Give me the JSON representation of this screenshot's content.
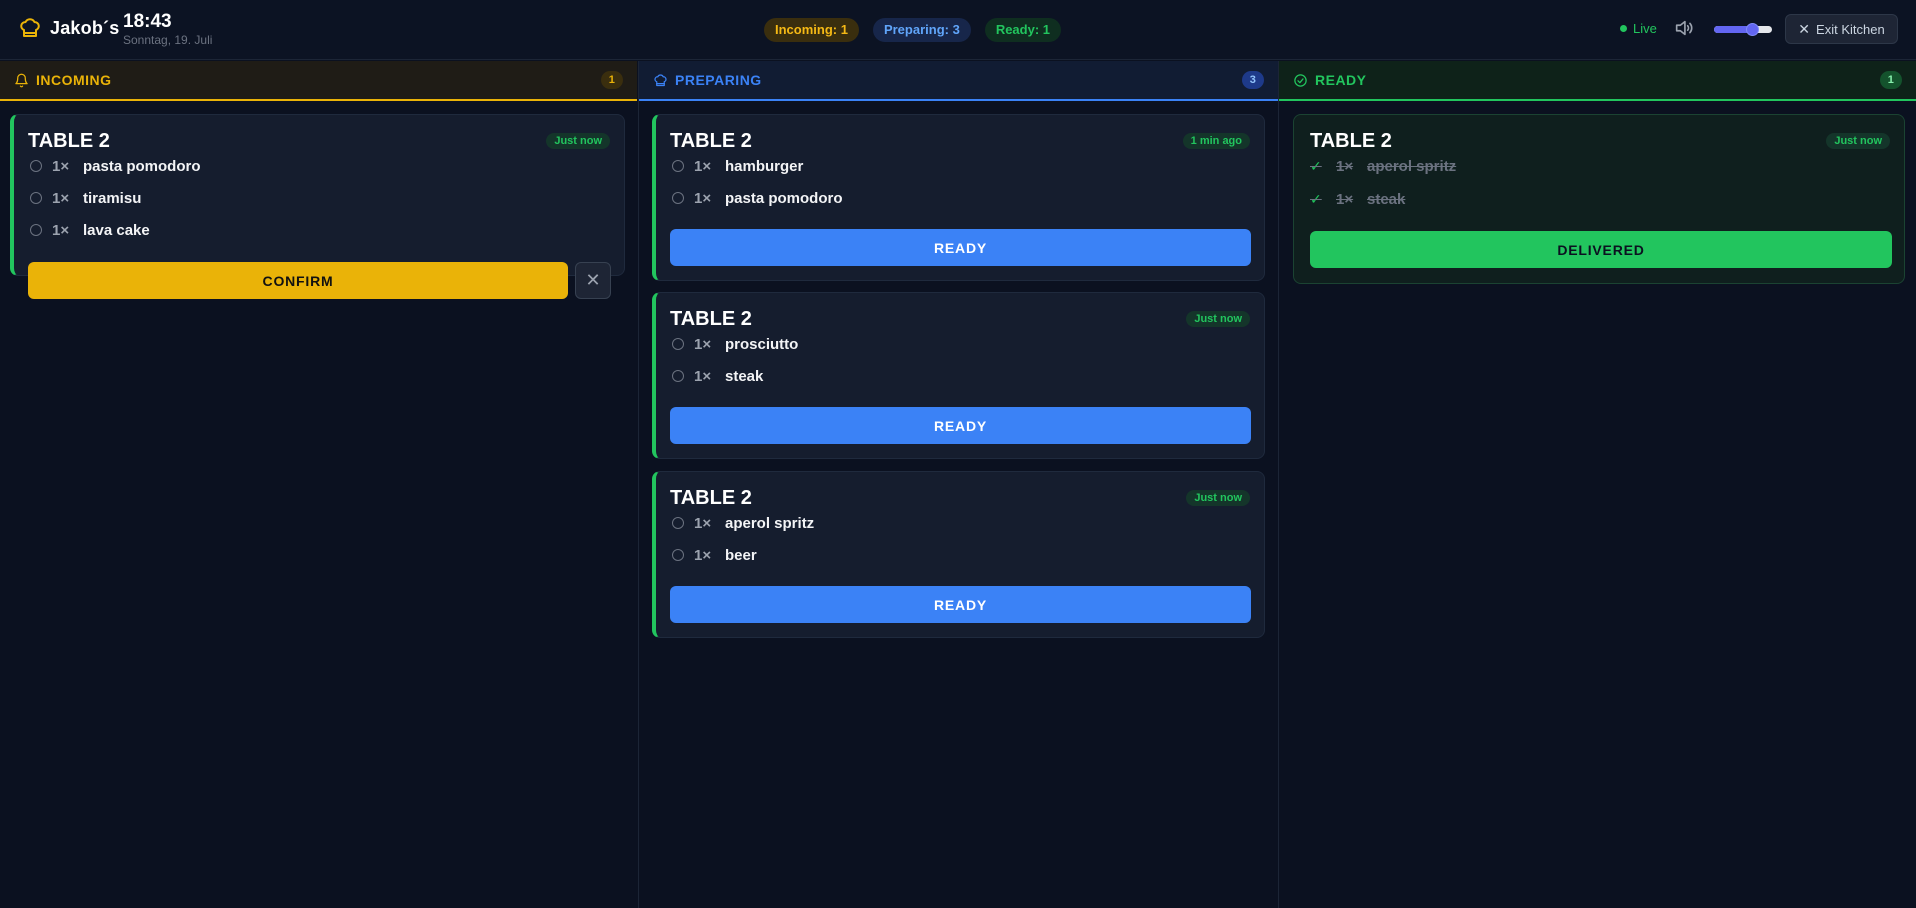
{
  "header": {
    "brand": "Jakob´s",
    "time": "18:43",
    "date": "Sonntag, 19. Juli",
    "stats": {
      "incoming": "Incoming: 1",
      "preparing": "Preparing: 3",
      "ready": "Ready: 1"
    },
    "live_label": "Live",
    "volume": 0.72,
    "exit_label": "Exit Kitchen",
    "colors": {
      "accent_volume": "#6366f1",
      "live": "#22c55e"
    }
  },
  "columns": {
    "incoming": {
      "title": "INCOMING",
      "count": "1",
      "color": "#eab308",
      "orders": [
        {
          "table": "TABLE 2",
          "time": "Just now",
          "items": [
            {
              "qty": "1×",
              "name": "pasta pomodoro"
            },
            {
              "qty": "1×",
              "name": "tiramisu"
            },
            {
              "qty": "1×",
              "name": "lava cake"
            }
          ],
          "action": "CONFIRM",
          "reject_icon": "close-icon"
        }
      ]
    },
    "preparing": {
      "title": "PREPARING",
      "count": "3",
      "color": "#3b82f6",
      "orders": [
        {
          "table": "TABLE 2",
          "time": "1 min ago",
          "items": [
            {
              "qty": "1×",
              "name": "hamburger"
            },
            {
              "qty": "1×",
              "name": "pasta pomodoro"
            }
          ],
          "action": "READY"
        },
        {
          "table": "TABLE 2",
          "time": "Just now",
          "items": [
            {
              "qty": "1×",
              "name": "prosciutto"
            },
            {
              "qty": "1×",
              "name": "steak"
            }
          ],
          "action": "READY"
        },
        {
          "table": "TABLE 2",
          "time": "Just now",
          "items": [
            {
              "qty": "1×",
              "name": "aperol spritz"
            },
            {
              "qty": "1×",
              "name": "beer"
            }
          ],
          "action": "READY"
        }
      ]
    },
    "ready": {
      "title": "READY",
      "count": "1",
      "color": "#22c55e",
      "orders": [
        {
          "table": "TABLE 2",
          "time": "Just now",
          "items": [
            {
              "qty": "1×",
              "name": "aperol spritz"
            },
            {
              "qty": "1×",
              "name": "steak"
            }
          ],
          "action": "DELIVERED"
        }
      ]
    }
  }
}
